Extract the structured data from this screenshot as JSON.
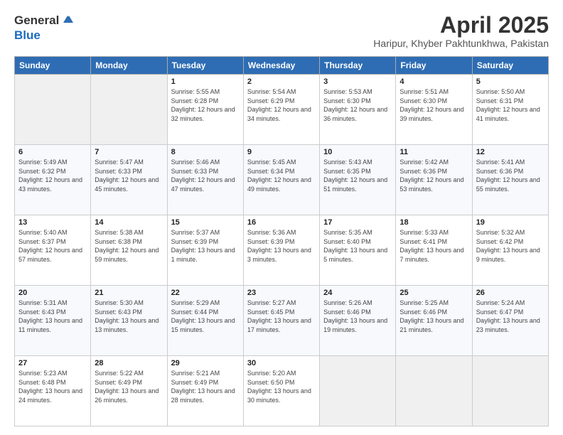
{
  "logo": {
    "general": "General",
    "blue": "Blue"
  },
  "title": "April 2025",
  "subtitle": "Haripur, Khyber Pakhtunkhwa, Pakistan",
  "days_of_week": [
    "Sunday",
    "Monday",
    "Tuesday",
    "Wednesday",
    "Thursday",
    "Friday",
    "Saturday"
  ],
  "weeks": [
    [
      {
        "day": "",
        "sunrise": "",
        "sunset": "",
        "daylight": ""
      },
      {
        "day": "",
        "sunrise": "",
        "sunset": "",
        "daylight": ""
      },
      {
        "day": "1",
        "sunrise": "Sunrise: 5:55 AM",
        "sunset": "Sunset: 6:28 PM",
        "daylight": "Daylight: 12 hours and 32 minutes."
      },
      {
        "day": "2",
        "sunrise": "Sunrise: 5:54 AM",
        "sunset": "Sunset: 6:29 PM",
        "daylight": "Daylight: 12 hours and 34 minutes."
      },
      {
        "day": "3",
        "sunrise": "Sunrise: 5:53 AM",
        "sunset": "Sunset: 6:30 PM",
        "daylight": "Daylight: 12 hours and 36 minutes."
      },
      {
        "day": "4",
        "sunrise": "Sunrise: 5:51 AM",
        "sunset": "Sunset: 6:30 PM",
        "daylight": "Daylight: 12 hours and 39 minutes."
      },
      {
        "day": "5",
        "sunrise": "Sunrise: 5:50 AM",
        "sunset": "Sunset: 6:31 PM",
        "daylight": "Daylight: 12 hours and 41 minutes."
      }
    ],
    [
      {
        "day": "6",
        "sunrise": "Sunrise: 5:49 AM",
        "sunset": "Sunset: 6:32 PM",
        "daylight": "Daylight: 12 hours and 43 minutes."
      },
      {
        "day": "7",
        "sunrise": "Sunrise: 5:47 AM",
        "sunset": "Sunset: 6:33 PM",
        "daylight": "Daylight: 12 hours and 45 minutes."
      },
      {
        "day": "8",
        "sunrise": "Sunrise: 5:46 AM",
        "sunset": "Sunset: 6:33 PM",
        "daylight": "Daylight: 12 hours and 47 minutes."
      },
      {
        "day": "9",
        "sunrise": "Sunrise: 5:45 AM",
        "sunset": "Sunset: 6:34 PM",
        "daylight": "Daylight: 12 hours and 49 minutes."
      },
      {
        "day": "10",
        "sunrise": "Sunrise: 5:43 AM",
        "sunset": "Sunset: 6:35 PM",
        "daylight": "Daylight: 12 hours and 51 minutes."
      },
      {
        "day": "11",
        "sunrise": "Sunrise: 5:42 AM",
        "sunset": "Sunset: 6:36 PM",
        "daylight": "Daylight: 12 hours and 53 minutes."
      },
      {
        "day": "12",
        "sunrise": "Sunrise: 5:41 AM",
        "sunset": "Sunset: 6:36 PM",
        "daylight": "Daylight: 12 hours and 55 minutes."
      }
    ],
    [
      {
        "day": "13",
        "sunrise": "Sunrise: 5:40 AM",
        "sunset": "Sunset: 6:37 PM",
        "daylight": "Daylight: 12 hours and 57 minutes."
      },
      {
        "day": "14",
        "sunrise": "Sunrise: 5:38 AM",
        "sunset": "Sunset: 6:38 PM",
        "daylight": "Daylight: 12 hours and 59 minutes."
      },
      {
        "day": "15",
        "sunrise": "Sunrise: 5:37 AM",
        "sunset": "Sunset: 6:39 PM",
        "daylight": "Daylight: 13 hours and 1 minute."
      },
      {
        "day": "16",
        "sunrise": "Sunrise: 5:36 AM",
        "sunset": "Sunset: 6:39 PM",
        "daylight": "Daylight: 13 hours and 3 minutes."
      },
      {
        "day": "17",
        "sunrise": "Sunrise: 5:35 AM",
        "sunset": "Sunset: 6:40 PM",
        "daylight": "Daylight: 13 hours and 5 minutes."
      },
      {
        "day": "18",
        "sunrise": "Sunrise: 5:33 AM",
        "sunset": "Sunset: 6:41 PM",
        "daylight": "Daylight: 13 hours and 7 minutes."
      },
      {
        "day": "19",
        "sunrise": "Sunrise: 5:32 AM",
        "sunset": "Sunset: 6:42 PM",
        "daylight": "Daylight: 13 hours and 9 minutes."
      }
    ],
    [
      {
        "day": "20",
        "sunrise": "Sunrise: 5:31 AM",
        "sunset": "Sunset: 6:43 PM",
        "daylight": "Daylight: 13 hours and 11 minutes."
      },
      {
        "day": "21",
        "sunrise": "Sunrise: 5:30 AM",
        "sunset": "Sunset: 6:43 PM",
        "daylight": "Daylight: 13 hours and 13 minutes."
      },
      {
        "day": "22",
        "sunrise": "Sunrise: 5:29 AM",
        "sunset": "Sunset: 6:44 PM",
        "daylight": "Daylight: 13 hours and 15 minutes."
      },
      {
        "day": "23",
        "sunrise": "Sunrise: 5:27 AM",
        "sunset": "Sunset: 6:45 PM",
        "daylight": "Daylight: 13 hours and 17 minutes."
      },
      {
        "day": "24",
        "sunrise": "Sunrise: 5:26 AM",
        "sunset": "Sunset: 6:46 PM",
        "daylight": "Daylight: 13 hours and 19 minutes."
      },
      {
        "day": "25",
        "sunrise": "Sunrise: 5:25 AM",
        "sunset": "Sunset: 6:46 PM",
        "daylight": "Daylight: 13 hours and 21 minutes."
      },
      {
        "day": "26",
        "sunrise": "Sunrise: 5:24 AM",
        "sunset": "Sunset: 6:47 PM",
        "daylight": "Daylight: 13 hours and 23 minutes."
      }
    ],
    [
      {
        "day": "27",
        "sunrise": "Sunrise: 5:23 AM",
        "sunset": "Sunset: 6:48 PM",
        "daylight": "Daylight: 13 hours and 24 minutes."
      },
      {
        "day": "28",
        "sunrise": "Sunrise: 5:22 AM",
        "sunset": "Sunset: 6:49 PM",
        "daylight": "Daylight: 13 hours and 26 minutes."
      },
      {
        "day": "29",
        "sunrise": "Sunrise: 5:21 AM",
        "sunset": "Sunset: 6:49 PM",
        "daylight": "Daylight: 13 hours and 28 minutes."
      },
      {
        "day": "30",
        "sunrise": "Sunrise: 5:20 AM",
        "sunset": "Sunset: 6:50 PM",
        "daylight": "Daylight: 13 hours and 30 minutes."
      },
      {
        "day": "",
        "sunrise": "",
        "sunset": "",
        "daylight": ""
      },
      {
        "day": "",
        "sunrise": "",
        "sunset": "",
        "daylight": ""
      },
      {
        "day": "",
        "sunrise": "",
        "sunset": "",
        "daylight": ""
      }
    ]
  ]
}
